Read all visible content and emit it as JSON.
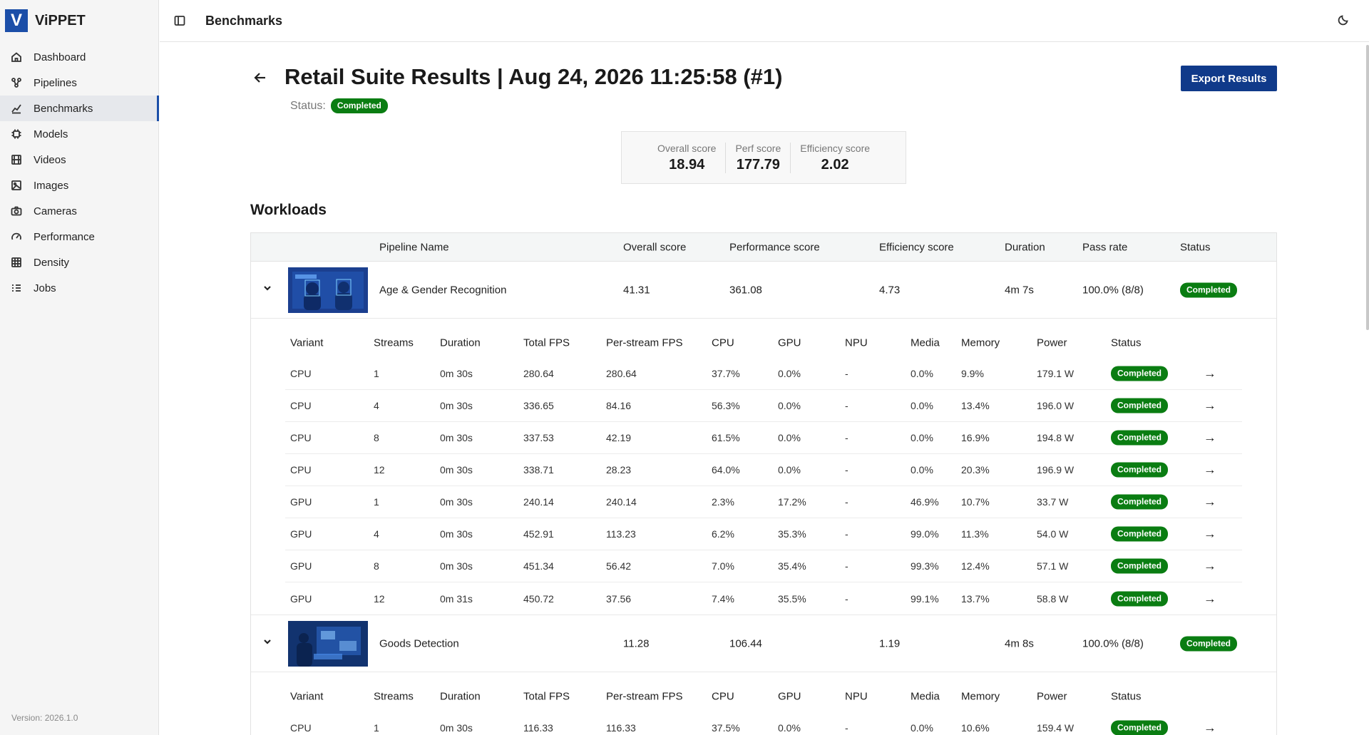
{
  "app": {
    "name": "ViPPET",
    "logo_letter": "V",
    "version": "Version: 2026.1.0",
    "accent": "#1b4ea8"
  },
  "nav": [
    {
      "label": "Dashboard",
      "icon": "home-icon"
    },
    {
      "label": "Pipelines",
      "icon": "pipeline-icon"
    },
    {
      "label": "Benchmarks",
      "icon": "chart-icon",
      "active": true
    },
    {
      "label": "Models",
      "icon": "chip-icon"
    },
    {
      "label": "Videos",
      "icon": "film-icon"
    },
    {
      "label": "Images",
      "icon": "image-icon"
    },
    {
      "label": "Cameras",
      "icon": "camera-icon"
    },
    {
      "label": "Performance",
      "icon": "gauge-icon"
    },
    {
      "label": "Density",
      "icon": "grid-icon"
    },
    {
      "label": "Jobs",
      "icon": "list-icon"
    }
  ],
  "header": {
    "title": "Benchmarks"
  },
  "page": {
    "title": "Retail Suite Results | Aug 24, 2026 11:25:58 (#1)",
    "status_label": "Status:",
    "status": "Completed",
    "export_label": "Export Results"
  },
  "scores": [
    {
      "label": "Overall score",
      "value": "18.94"
    },
    {
      "label": "Perf score",
      "value": "177.79"
    },
    {
      "label": "Efficiency score",
      "value": "2.02"
    }
  ],
  "workloads": {
    "title": "Workloads",
    "columns": [
      "Pipeline Name",
      "Overall score",
      "Performance score",
      "Efficiency score",
      "Duration",
      "Pass rate",
      "Status"
    ],
    "variant_columns": [
      "Variant",
      "Streams",
      "Duration",
      "Total FPS",
      "Per-stream FPS",
      "CPU",
      "GPU",
      "NPU",
      "Media",
      "Memory",
      "Power",
      "Status"
    ],
    "rows": [
      {
        "name": "Age & Gender Recognition",
        "overall": "41.31",
        "perf": "361.08",
        "eff": "4.73",
        "duration": "4m 7s",
        "pass": "100.0% (8/8)",
        "status": "Completed",
        "variants": [
          [
            "CPU",
            "1",
            "0m 30s",
            "280.64",
            "280.64",
            "37.7%",
            "0.0%",
            "-",
            "0.0%",
            "9.9%",
            "179.1 W",
            "Completed"
          ],
          [
            "CPU",
            "4",
            "0m 30s",
            "336.65",
            "84.16",
            "56.3%",
            "0.0%",
            "-",
            "0.0%",
            "13.4%",
            "196.0 W",
            "Completed"
          ],
          [
            "CPU",
            "8",
            "0m 30s",
            "337.53",
            "42.19",
            "61.5%",
            "0.0%",
            "-",
            "0.0%",
            "16.9%",
            "194.8 W",
            "Completed"
          ],
          [
            "CPU",
            "12",
            "0m 30s",
            "338.71",
            "28.23",
            "64.0%",
            "0.0%",
            "-",
            "0.0%",
            "20.3%",
            "196.9 W",
            "Completed"
          ],
          [
            "GPU",
            "1",
            "0m 30s",
            "240.14",
            "240.14",
            "2.3%",
            "17.2%",
            "-",
            "46.9%",
            "10.7%",
            "33.7 W",
            "Completed"
          ],
          [
            "GPU",
            "4",
            "0m 30s",
            "452.91",
            "113.23",
            "6.2%",
            "35.3%",
            "-",
            "99.0%",
            "11.3%",
            "54.0 W",
            "Completed"
          ],
          [
            "GPU",
            "8",
            "0m 30s",
            "451.34",
            "56.42",
            "7.0%",
            "35.4%",
            "-",
            "99.3%",
            "12.4%",
            "57.1 W",
            "Completed"
          ],
          [
            "GPU",
            "12",
            "0m 31s",
            "450.72",
            "37.56",
            "7.4%",
            "35.5%",
            "-",
            "99.1%",
            "13.7%",
            "58.8 W",
            "Completed"
          ]
        ]
      },
      {
        "name": "Goods Detection",
        "overall": "11.28",
        "perf": "106.44",
        "eff": "1.19",
        "duration": "4m 8s",
        "pass": "100.0% (8/8)",
        "status": "Completed",
        "variants": [
          [
            "CPU",
            "1",
            "0m 30s",
            "116.33",
            "116.33",
            "37.5%",
            "0.0%",
            "-",
            "0.0%",
            "10.6%",
            "159.4 W",
            "Completed"
          ]
        ]
      }
    ]
  },
  "colors": {
    "success": "#0a7d12",
    "button": "#103a8a"
  }
}
